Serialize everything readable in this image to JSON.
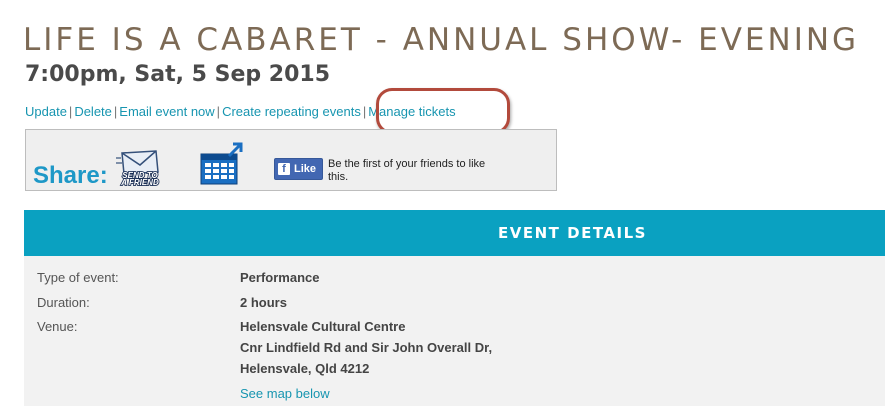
{
  "event": {
    "title": "LIFE IS A CABARET - ANNUAL SHOW- EVENING",
    "datetime": "7:00pm, Sat, 5 Sep 2015"
  },
  "actions": {
    "update": "Update",
    "delete": "Delete",
    "email": "Email event now",
    "repeating": "Create repeating events",
    "manage": "Manage tickets",
    "separator": "|"
  },
  "share": {
    "label": "Share:",
    "send_friend_icon": "send-to-a-friend-envelope",
    "calendar_icon": "add-to-calendar",
    "send_friend_text_1": "SEND TO",
    "send_friend_text_2": "A FRIEND",
    "fb_like_label": "Like",
    "fb_logo": "f",
    "fb_text": "Be the first of your friends to like this."
  },
  "details": {
    "header": "EVENT DETAILS",
    "type_label": "Type of event:",
    "type_value": "Performance",
    "duration_label": "Duration:",
    "duration_value": "2 hours",
    "venue_label": "Venue:",
    "venue_name": "Helensvale Cultural Centre",
    "venue_address_1": "Cnr Lindfield Rd and Sir John Overall Dr,",
    "venue_address_2": "Helensvale, Qld 4212",
    "map_link": "See map below"
  },
  "colors": {
    "accent": "#0aa1c1",
    "link": "#1795b0",
    "title": "#7d6a55",
    "highlight": "#b24a3c"
  }
}
